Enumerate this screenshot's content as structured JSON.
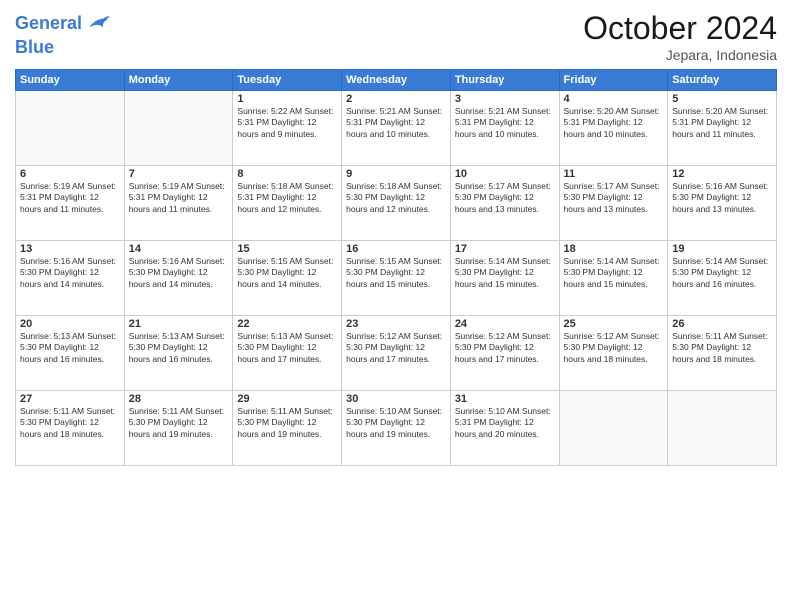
{
  "logo": {
    "line1": "General",
    "line2": "Blue"
  },
  "title": "October 2024",
  "location": "Jepara, Indonesia",
  "days_header": [
    "Sunday",
    "Monday",
    "Tuesday",
    "Wednesday",
    "Thursday",
    "Friday",
    "Saturday"
  ],
  "weeks": [
    [
      {
        "day": "",
        "info": ""
      },
      {
        "day": "",
        "info": ""
      },
      {
        "day": "1",
        "info": "Sunrise: 5:22 AM\nSunset: 5:31 PM\nDaylight: 12 hours\nand 9 minutes."
      },
      {
        "day": "2",
        "info": "Sunrise: 5:21 AM\nSunset: 5:31 PM\nDaylight: 12 hours\nand 10 minutes."
      },
      {
        "day": "3",
        "info": "Sunrise: 5:21 AM\nSunset: 5:31 PM\nDaylight: 12 hours\nand 10 minutes."
      },
      {
        "day": "4",
        "info": "Sunrise: 5:20 AM\nSunset: 5:31 PM\nDaylight: 12 hours\nand 10 minutes."
      },
      {
        "day": "5",
        "info": "Sunrise: 5:20 AM\nSunset: 5:31 PM\nDaylight: 12 hours\nand 11 minutes."
      }
    ],
    [
      {
        "day": "6",
        "info": "Sunrise: 5:19 AM\nSunset: 5:31 PM\nDaylight: 12 hours\nand 11 minutes."
      },
      {
        "day": "7",
        "info": "Sunrise: 5:19 AM\nSunset: 5:31 PM\nDaylight: 12 hours\nand 11 minutes."
      },
      {
        "day": "8",
        "info": "Sunrise: 5:18 AM\nSunset: 5:31 PM\nDaylight: 12 hours\nand 12 minutes."
      },
      {
        "day": "9",
        "info": "Sunrise: 5:18 AM\nSunset: 5:30 PM\nDaylight: 12 hours\nand 12 minutes."
      },
      {
        "day": "10",
        "info": "Sunrise: 5:17 AM\nSunset: 5:30 PM\nDaylight: 12 hours\nand 13 minutes."
      },
      {
        "day": "11",
        "info": "Sunrise: 5:17 AM\nSunset: 5:30 PM\nDaylight: 12 hours\nand 13 minutes."
      },
      {
        "day": "12",
        "info": "Sunrise: 5:16 AM\nSunset: 5:30 PM\nDaylight: 12 hours\nand 13 minutes."
      }
    ],
    [
      {
        "day": "13",
        "info": "Sunrise: 5:16 AM\nSunset: 5:30 PM\nDaylight: 12 hours\nand 14 minutes."
      },
      {
        "day": "14",
        "info": "Sunrise: 5:16 AM\nSunset: 5:30 PM\nDaylight: 12 hours\nand 14 minutes."
      },
      {
        "day": "15",
        "info": "Sunrise: 5:15 AM\nSunset: 5:30 PM\nDaylight: 12 hours\nand 14 minutes."
      },
      {
        "day": "16",
        "info": "Sunrise: 5:15 AM\nSunset: 5:30 PM\nDaylight: 12 hours\nand 15 minutes."
      },
      {
        "day": "17",
        "info": "Sunrise: 5:14 AM\nSunset: 5:30 PM\nDaylight: 12 hours\nand 15 minutes."
      },
      {
        "day": "18",
        "info": "Sunrise: 5:14 AM\nSunset: 5:30 PM\nDaylight: 12 hours\nand 15 minutes."
      },
      {
        "day": "19",
        "info": "Sunrise: 5:14 AM\nSunset: 5:30 PM\nDaylight: 12 hours\nand 16 minutes."
      }
    ],
    [
      {
        "day": "20",
        "info": "Sunrise: 5:13 AM\nSunset: 5:30 PM\nDaylight: 12 hours\nand 16 minutes."
      },
      {
        "day": "21",
        "info": "Sunrise: 5:13 AM\nSunset: 5:30 PM\nDaylight: 12 hours\nand 16 minutes."
      },
      {
        "day": "22",
        "info": "Sunrise: 5:13 AM\nSunset: 5:30 PM\nDaylight: 12 hours\nand 17 minutes."
      },
      {
        "day": "23",
        "info": "Sunrise: 5:12 AM\nSunset: 5:30 PM\nDaylight: 12 hours\nand 17 minutes."
      },
      {
        "day": "24",
        "info": "Sunrise: 5:12 AM\nSunset: 5:30 PM\nDaylight: 12 hours\nand 17 minutes."
      },
      {
        "day": "25",
        "info": "Sunrise: 5:12 AM\nSunset: 5:30 PM\nDaylight: 12 hours\nand 18 minutes."
      },
      {
        "day": "26",
        "info": "Sunrise: 5:11 AM\nSunset: 5:30 PM\nDaylight: 12 hours\nand 18 minutes."
      }
    ],
    [
      {
        "day": "27",
        "info": "Sunrise: 5:11 AM\nSunset: 5:30 PM\nDaylight: 12 hours\nand 18 minutes."
      },
      {
        "day": "28",
        "info": "Sunrise: 5:11 AM\nSunset: 5:30 PM\nDaylight: 12 hours\nand 19 minutes."
      },
      {
        "day": "29",
        "info": "Sunrise: 5:11 AM\nSunset: 5:30 PM\nDaylight: 12 hours\nand 19 minutes."
      },
      {
        "day": "30",
        "info": "Sunrise: 5:10 AM\nSunset: 5:30 PM\nDaylight: 12 hours\nand 19 minutes."
      },
      {
        "day": "31",
        "info": "Sunrise: 5:10 AM\nSunset: 5:31 PM\nDaylight: 12 hours\nand 20 minutes."
      },
      {
        "day": "",
        "info": ""
      },
      {
        "day": "",
        "info": ""
      }
    ]
  ]
}
